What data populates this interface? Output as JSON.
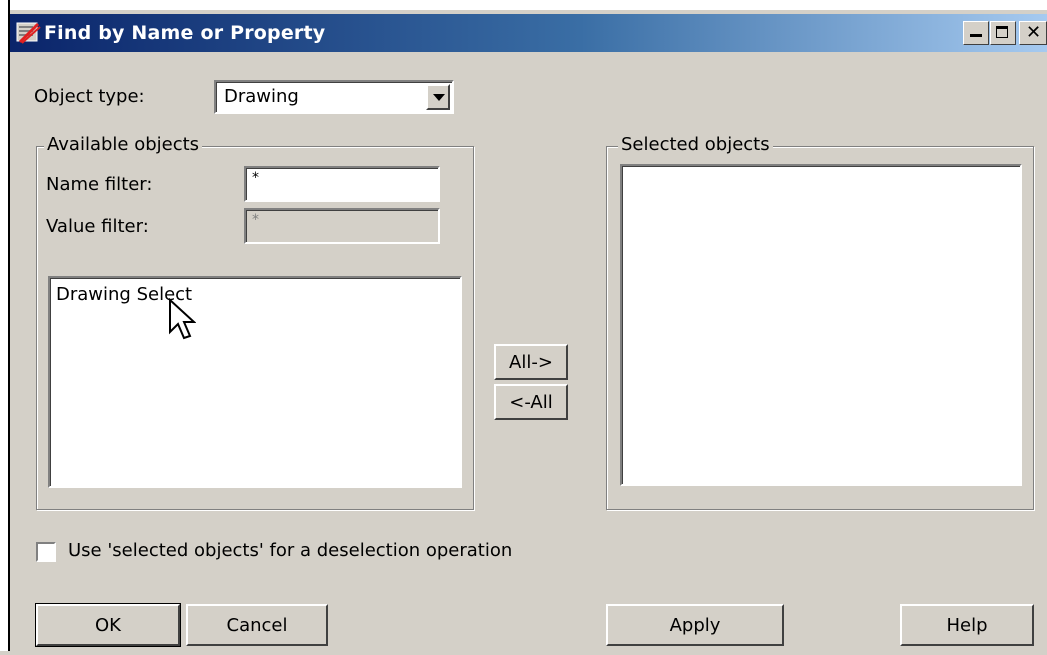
{
  "window": {
    "title": "Find by Name or Property",
    "controls": [
      "minimize",
      "maximize",
      "close"
    ]
  },
  "object_type": {
    "label": "Object type:",
    "selected": "Drawing"
  },
  "available_objects": {
    "group_label": "Available objects",
    "name_filter_label": "Name filter:",
    "name_filter_value": "*",
    "value_filter_label": "Value filter:",
    "value_filter_value": "*",
    "items": [
      "Drawing Select"
    ]
  },
  "transfer": {
    "all_right": "All->",
    "all_left": "<-All"
  },
  "selected_objects": {
    "group_label": "Selected objects",
    "items": []
  },
  "deselect_option": {
    "label": "Use 'selected objects' for a deselection operation",
    "checked": false
  },
  "buttons": {
    "ok": "OK",
    "cancel": "Cancel",
    "apply": "Apply",
    "help": "Help"
  }
}
